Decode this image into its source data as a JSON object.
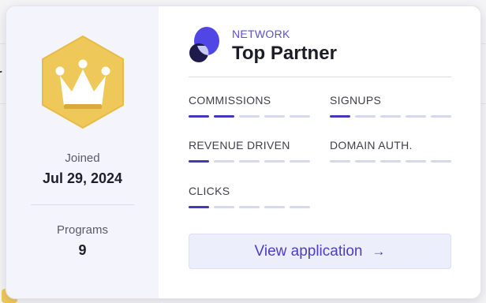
{
  "background": {
    "left_fragment_text": "r"
  },
  "profile": {
    "joined_label": "Joined",
    "joined_date": "Jul 29, 2024",
    "programs_label": "Programs",
    "programs_count": "9"
  },
  "badge": {
    "icon": "crown-icon",
    "color": "#efc85a"
  },
  "network": {
    "eyebrow": "NETWORK",
    "name": "Top Partner",
    "logo_colors": [
      "#4f46e5",
      "#1e1b4b",
      "#c7c8f5"
    ]
  },
  "metrics": [
    {
      "label": "COMMISSIONS",
      "level": 2,
      "max": 5
    },
    {
      "label": "SIGNUPS",
      "level": 1,
      "max": 5
    },
    {
      "label": "REVENUE DRIVEN",
      "level": 1,
      "max": 5
    },
    {
      "label": "DOMAIN AUTH.",
      "level": 0,
      "max": 5
    },
    {
      "label": "CLICKS",
      "level": 1,
      "max": 5
    }
  ],
  "action": {
    "label": "View application",
    "arrow": "→"
  },
  "colors": {
    "accent": "#4338b8",
    "bar_inactive": "#d6d8f0",
    "button_bg": "#eceefb",
    "left_panel_bg": "#f3f4fc"
  }
}
